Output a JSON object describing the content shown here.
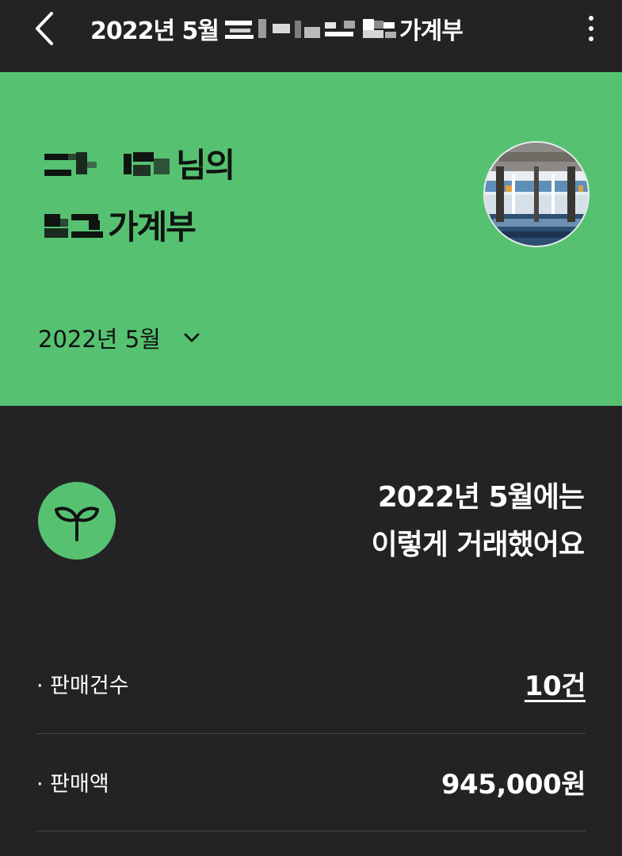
{
  "appbar": {
    "title_prefix": "2022년 5월",
    "title_suffix": "가계부"
  },
  "hero": {
    "line1_suffix": "님의",
    "line2_suffix": "가계부",
    "month_label": "2022년 5월"
  },
  "summary": {
    "heading_line1": "2022년 5월에는",
    "heading_line2": "이렇게 거래했어요",
    "rows": [
      {
        "label": "· 판매건수",
        "value": "10건"
      },
      {
        "label": "· 판매액",
        "value": "945,000원"
      }
    ]
  },
  "colors": {
    "accent": "#56c271",
    "background": "#232325",
    "divider": "#45464a"
  },
  "icons": {
    "back": "chevron-left-icon",
    "more": "more-vertical-icon",
    "dropdown": "chevron-down-icon",
    "sprout": "sprout-icon"
  }
}
